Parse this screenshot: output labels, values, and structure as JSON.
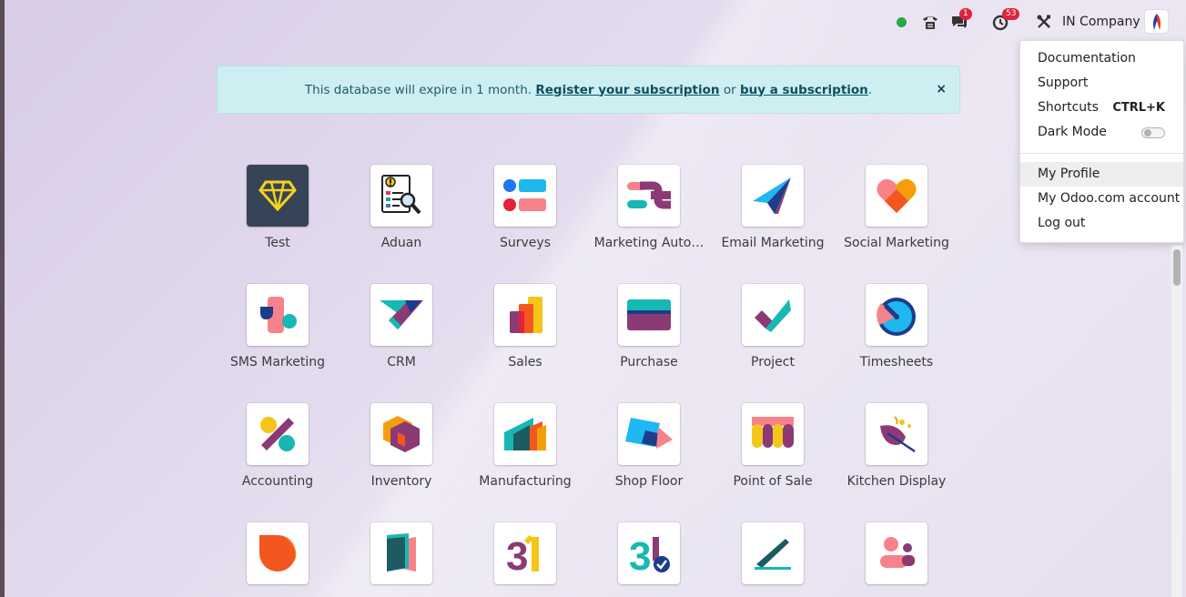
{
  "topbar": {
    "company": "IN Company",
    "messages_count": "1",
    "activities_count": "53"
  },
  "banner": {
    "text_before": "This database will expire in 1 month.",
    "register_link": "Register your subscription",
    "or_text": "or",
    "buy_link": "buy a subscription",
    "period": ".",
    "close": "×"
  },
  "apps": [
    {
      "label": "Test",
      "icon": "diamond-icon"
    },
    {
      "label": "Aduan",
      "icon": "report-search-icon"
    },
    {
      "label": "Surveys",
      "icon": "surveys-icon"
    },
    {
      "label": "Marketing Auto…",
      "icon": "marketing-automation-icon"
    },
    {
      "label": "Email Marketing",
      "icon": "paper-plane-icon"
    },
    {
      "label": "Social Marketing",
      "icon": "heart-icon"
    },
    {
      "label": "SMS Marketing",
      "icon": "sms-marketing-icon"
    },
    {
      "label": "CRM",
      "icon": "handshake-icon"
    },
    {
      "label": "Sales",
      "icon": "bar-chart-icon"
    },
    {
      "label": "Purchase",
      "icon": "card-icon"
    },
    {
      "label": "Project",
      "icon": "checkmark-icon"
    },
    {
      "label": "Timesheets",
      "icon": "stopwatch-icon"
    },
    {
      "label": "Accounting",
      "icon": "percent-icon"
    },
    {
      "label": "Inventory",
      "icon": "box-icon"
    },
    {
      "label": "Manufacturing",
      "icon": "factory-icon"
    },
    {
      "label": "Shop Floor",
      "icon": "tablet-icon"
    },
    {
      "label": "Point of Sale",
      "icon": "shop-awning-icon"
    },
    {
      "label": "Kitchen Display",
      "icon": "leaf-icon"
    },
    {
      "label": "",
      "icon": "chat-bubble-icon"
    },
    {
      "label": "",
      "icon": "book-icon"
    },
    {
      "label": "",
      "icon": "calendar-31-icon"
    },
    {
      "label": "",
      "icon": "calendar-check-icon"
    },
    {
      "label": "",
      "icon": "pen-icon"
    },
    {
      "label": "",
      "icon": "people-icon"
    }
  ],
  "dropdown": {
    "documentation": "Documentation",
    "support": "Support",
    "shortcuts": "Shortcuts",
    "shortcuts_key": "CTRL+K",
    "dark_mode": "Dark Mode",
    "my_profile": "My Profile",
    "odoo_account": "My Odoo.com account",
    "logout": "Log out"
  },
  "colors": {
    "banner_bg": "#cdeff2",
    "badge": "#e0223a",
    "status_online": "#28a745"
  }
}
